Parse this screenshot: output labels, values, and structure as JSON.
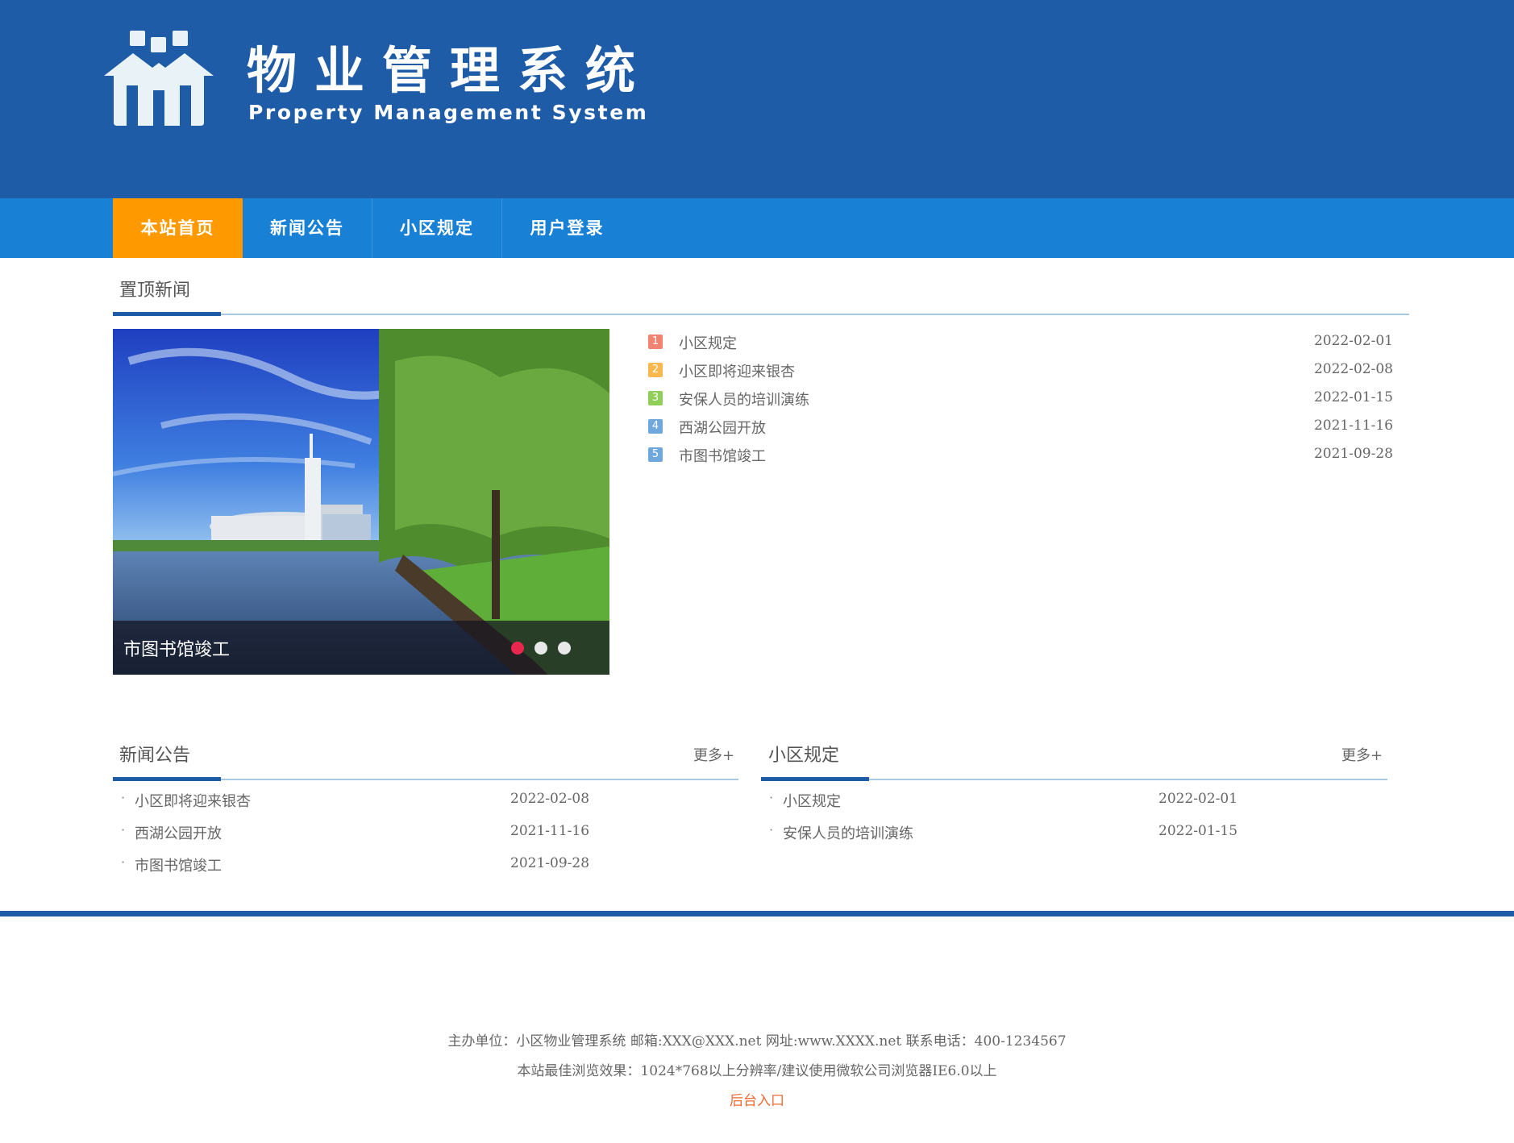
{
  "header": {
    "title": "物业管理系统",
    "subtitle": "Property Management System",
    "logo_icon": "houses-logo-icon",
    "bg_color": "#1f5ca8"
  },
  "nav": {
    "items": [
      {
        "label": "本站首页",
        "active": true
      },
      {
        "label": "新闻公告",
        "active": false
      },
      {
        "label": "小区规定",
        "active": false
      },
      {
        "label": "用户登录",
        "active": false
      }
    ],
    "bg_color": "#1881d6",
    "active_color": "#ff9900"
  },
  "top_news": {
    "title": "置顶新闻",
    "slider": {
      "caption": "市图书馆竣工",
      "dots": 3,
      "active_dot": 1
    },
    "items": [
      {
        "rank": "1",
        "title": "小区规定",
        "date": "2022-02-01",
        "color": "#f08470"
      },
      {
        "rank": "2",
        "title": "小区即将迎来银杏",
        "date": "2022-02-08",
        "color": "#f8b84e"
      },
      {
        "rank": "3",
        "title": "安保人员的培训演练",
        "date": "2022-01-15",
        "color": "#8fcf5a"
      },
      {
        "rank": "4",
        "title": "西湖公园开放",
        "date": "2021-11-16",
        "color": "#6fa8dc"
      },
      {
        "rank": "5",
        "title": "市图书馆竣工",
        "date": "2021-09-28",
        "color": "#6fa8dc"
      }
    ]
  },
  "news": {
    "title": "新闻公告",
    "more": "更多+",
    "items": [
      {
        "title": "小区即将迎来银杏",
        "date": "2022-02-08"
      },
      {
        "title": "西湖公园开放",
        "date": "2021-11-16"
      },
      {
        "title": "市图书馆竣工",
        "date": "2021-09-28"
      }
    ]
  },
  "rules": {
    "title": "小区规定",
    "more": "更多+",
    "items": [
      {
        "title": "小区规定",
        "date": "2022-02-01"
      },
      {
        "title": "安保人员的培训演练",
        "date": "2022-01-15"
      }
    ]
  },
  "footer": {
    "line1": "主办单位：小区物业管理系统  邮箱:XXX@XXX.net  网址:www.XXXX.net   联系电话：400-1234567",
    "line2": "本站最佳浏览效果：1024*768以上分辨率/建议使用微软公司浏览器IE6.0以上",
    "admin_link": "后台入口"
  }
}
